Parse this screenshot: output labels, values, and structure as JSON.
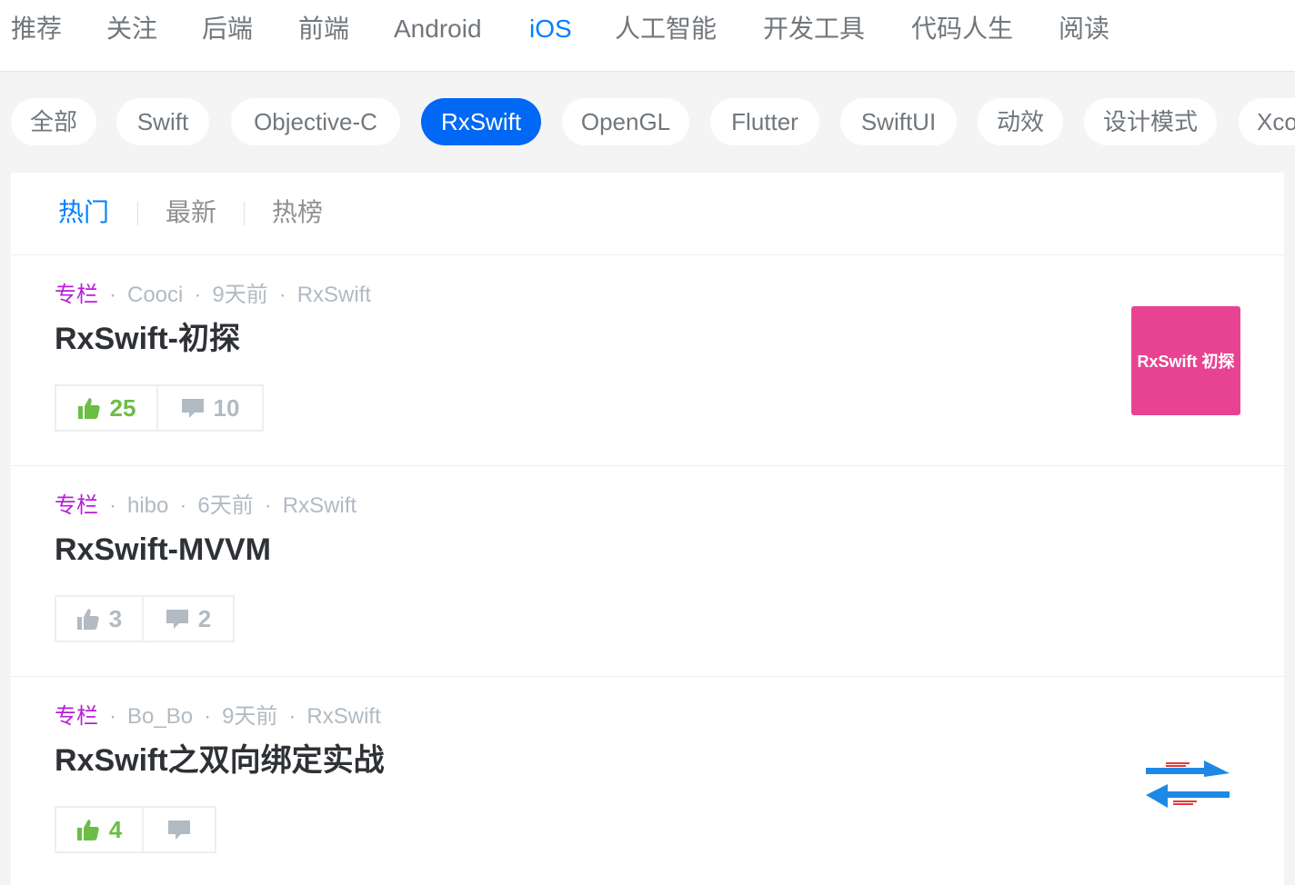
{
  "topnav": {
    "items": [
      "推荐",
      "关注",
      "后端",
      "前端",
      "Android",
      "iOS",
      "人工智能",
      "开发工具",
      "代码人生",
      "阅读"
    ],
    "active": "iOS"
  },
  "tags": {
    "items": [
      "全部",
      "Swift",
      "Objective-C",
      "RxSwift",
      "OpenGL",
      "Flutter",
      "SwiftUI",
      "动效",
      "设计模式",
      "Xcode"
    ],
    "active": "RxSwift"
  },
  "sort": {
    "items": [
      "热门",
      "最新",
      "热榜"
    ],
    "active": "热门"
  },
  "entries": [
    {
      "column": "专栏",
      "author": "Cooci",
      "time": "9天前",
      "tag": "RxSwift",
      "title": "RxSwift-初探",
      "likes": "25",
      "comments": "10",
      "liked": true,
      "thumb_text": "RxSwift 初探",
      "thumb_color": "#e84393"
    },
    {
      "column": "专栏",
      "author": "hibo",
      "time": "6天前",
      "tag": "RxSwift",
      "title": "RxSwift-MVVM",
      "likes": "3",
      "comments": "2",
      "liked": false
    },
    {
      "column": "专栏",
      "author": "Bo_Bo",
      "time": "9天前",
      "tag": "RxSwift",
      "title": "RxSwift之双向绑定实战",
      "likes": "4",
      "comments": "",
      "liked": true
    }
  ],
  "colors": {
    "accent": "#007fff",
    "active_tag": "#0068f5",
    "column": "#b71ed7",
    "liked": "#6cbd45",
    "muted": "#b2bac2"
  }
}
